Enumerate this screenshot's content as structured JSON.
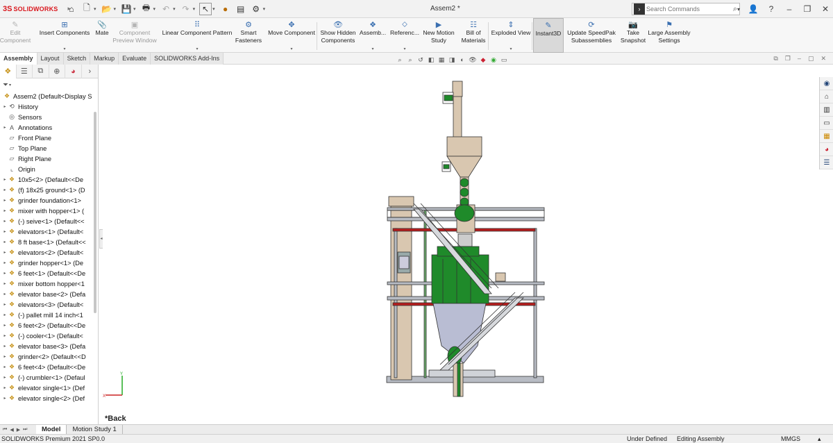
{
  "titlebar": {
    "logo_mark": "3S",
    "logo_text": "SOLIDWORKS",
    "document_title": "Assem2 *",
    "search_placeholder": "Search Commands"
  },
  "ribbon": {
    "items": [
      {
        "label1": "Edit",
        "label2": "Component",
        "icon": "edit-component-icon",
        "disabled": true
      },
      {
        "label1": "Insert Components",
        "label2": "",
        "icon": "insert-components-icon",
        "disabled": false
      },
      {
        "label1": "Mate",
        "label2": "",
        "icon": "mate-icon",
        "disabled": false
      },
      {
        "label1": "Component",
        "label2": "Preview Window",
        "icon": "component-preview-icon",
        "disabled": true
      },
      {
        "label1": "Linear Component Pattern",
        "label2": "",
        "icon": "linear-pattern-icon",
        "disabled": false
      },
      {
        "label1": "Smart",
        "label2": "Fasteners",
        "icon": "smart-fasteners-icon",
        "disabled": false
      },
      {
        "label1": "Move Component",
        "label2": "",
        "icon": "move-component-icon",
        "disabled": false
      },
      {
        "label1": "Show Hidden",
        "label2": "Components",
        "icon": "show-hidden-icon",
        "disabled": false
      },
      {
        "label1": "Assemb...",
        "label2": "",
        "icon": "assembly-features-icon",
        "disabled": false
      },
      {
        "label1": "Referenc...",
        "label2": "",
        "icon": "reference-geometry-icon",
        "disabled": false
      },
      {
        "label1": "New Motion",
        "label2": "Study",
        "icon": "motion-study-icon",
        "disabled": false
      },
      {
        "label1": "Bill of",
        "label2": "Materials",
        "icon": "bom-icon",
        "disabled": false
      },
      {
        "label1": "Exploded View",
        "label2": "",
        "icon": "exploded-view-icon",
        "disabled": false
      },
      {
        "label1": "Instant3D",
        "label2": "",
        "icon": "instant3d-icon",
        "disabled": false,
        "active": true
      },
      {
        "label1": "Update SpeedPak",
        "label2": "Subassemblies",
        "icon": "speedpak-icon",
        "disabled": false
      },
      {
        "label1": "Take",
        "label2": "Snapshot",
        "icon": "snapshot-icon",
        "disabled": false
      },
      {
        "label1": "Large Assembly",
        "label2": "Settings",
        "icon": "large-assembly-icon",
        "disabled": false
      }
    ]
  },
  "tabs": [
    "Assembly",
    "Layout",
    "Sketch",
    "Markup",
    "Evaluate",
    "SOLIDWORKS Add-Ins"
  ],
  "feature_tree": {
    "root": "Assem2  (Default<Display S",
    "items": [
      {
        "label": "History",
        "expand": true,
        "icon": "history-icon",
        "kind": "plain"
      },
      {
        "label": "Sensors",
        "expand": false,
        "icon": "sensors-icon",
        "kind": "plain"
      },
      {
        "label": "Annotations",
        "expand": true,
        "icon": "annotations-icon",
        "kind": "plain"
      },
      {
        "label": "Front Plane",
        "expand": false,
        "icon": "plane-icon",
        "kind": "plain"
      },
      {
        "label": "Top Plane",
        "expand": false,
        "icon": "plane-icon",
        "kind": "plain"
      },
      {
        "label": "Right Plane",
        "expand": false,
        "icon": "plane-icon",
        "kind": "plain"
      },
      {
        "label": "Origin",
        "expand": false,
        "icon": "origin-icon",
        "kind": "plain"
      },
      {
        "label": "10x5<2> (Default<<De",
        "expand": true,
        "icon": "part-icon",
        "kind": "part"
      },
      {
        "label": "(f) 18x25 ground<1> (D",
        "expand": true,
        "icon": "part-icon",
        "kind": "part"
      },
      {
        "label": "grinder foundation<1>",
        "expand": true,
        "icon": "part-icon",
        "kind": "part"
      },
      {
        "label": "mixer with hopper<1> (",
        "expand": true,
        "icon": "part-icon",
        "kind": "part"
      },
      {
        "label": "(-) seive<1> (Default<<",
        "expand": true,
        "icon": "part-icon",
        "kind": "part"
      },
      {
        "label": "elevators<1> (Default<",
        "expand": true,
        "icon": "part-icon",
        "kind": "part"
      },
      {
        "label": "8 ft base<1> (Default<<",
        "expand": true,
        "icon": "part-icon",
        "kind": "part"
      },
      {
        "label": "elevators<2> (Default<",
        "expand": true,
        "icon": "part-icon",
        "kind": "part"
      },
      {
        "label": "grinder hopper<1> (De",
        "expand": true,
        "icon": "part-icon",
        "kind": "part"
      },
      {
        "label": "6 feet<1> (Default<<De",
        "expand": true,
        "icon": "part-icon",
        "kind": "part"
      },
      {
        "label": "mixer bottom hopper<1",
        "expand": true,
        "icon": "part-icon",
        "kind": "part"
      },
      {
        "label": "elevator base<2> (Defa",
        "expand": true,
        "icon": "part-icon",
        "kind": "part"
      },
      {
        "label": "elevators<3> (Default<",
        "expand": true,
        "icon": "part-icon",
        "kind": "part"
      },
      {
        "label": "(-) pallet mill 14 inch<1",
        "expand": true,
        "icon": "part-icon",
        "kind": "part"
      },
      {
        "label": "6 feet<2> (Default<<De",
        "expand": true,
        "icon": "part-icon",
        "kind": "part"
      },
      {
        "label": "(-) cooler<1> (Default<",
        "expand": true,
        "icon": "part-icon",
        "kind": "part"
      },
      {
        "label": "elevator base<3> (Defa",
        "expand": true,
        "icon": "part-icon",
        "kind": "part"
      },
      {
        "label": "grinder<2> (Default<<D",
        "expand": true,
        "icon": "part-icon",
        "kind": "part"
      },
      {
        "label": "6 feet<4> (Default<<De",
        "expand": true,
        "icon": "part-icon",
        "kind": "part"
      },
      {
        "label": "(-) crumbler<1> (Defaul",
        "expand": true,
        "icon": "part-icon",
        "kind": "part"
      },
      {
        "label": "elevator single<1> (Def",
        "expand": true,
        "icon": "part-icon",
        "kind": "part"
      },
      {
        "label": "elevator single<2> (Def",
        "expand": true,
        "icon": "part-icon",
        "kind": "part"
      }
    ]
  },
  "viewport": {
    "view_label": "*Back",
    "triad_axes": {
      "y": "Y",
      "x": "X"
    }
  },
  "bottom_tabs": [
    "Model",
    "Motion Study 1"
  ],
  "status": {
    "app": "SOLIDWORKS Premium 2021 SP0.0",
    "state": "Under Defined",
    "mode": "Editing Assembly",
    "units": "MMGS"
  },
  "colors": {
    "green_machine": "#1f8a2a",
    "tan_part": "#d9c7b0",
    "frame_grey": "#b8bcc4",
    "red_beam": "#b81d1d"
  }
}
